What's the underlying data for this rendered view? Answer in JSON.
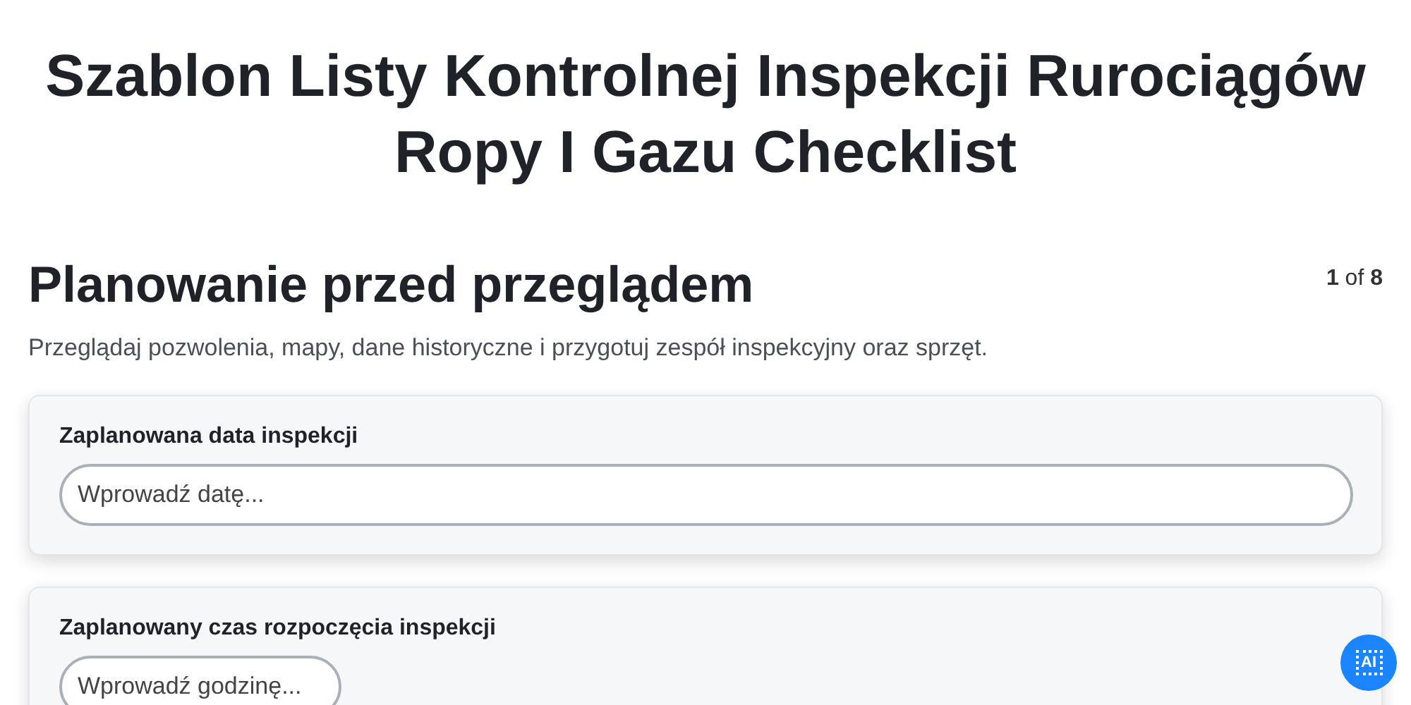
{
  "title": "Szablon Listy Kontrolnej Inspekcji Rurociągów Ropy I Gazu Checklist",
  "section": {
    "heading": "Planowanie przed przeglądem",
    "page_current": "1",
    "page_of": "of",
    "page_total": "8",
    "description": "Przeglądaj pozwolenia, mapy, dane historyczne i przygotuj zespół inspekcyjny oraz sprzęt."
  },
  "fields": [
    {
      "label": "Zaplanowana data inspekcji",
      "placeholder": "Wprowadź datę...",
      "kind": "date"
    },
    {
      "label": "Zaplanowany czas rozpoczęcia inspekcji",
      "placeholder": "Wprowadź godzinę...",
      "kind": "time"
    }
  ],
  "ai_button": {
    "label": "AI"
  }
}
